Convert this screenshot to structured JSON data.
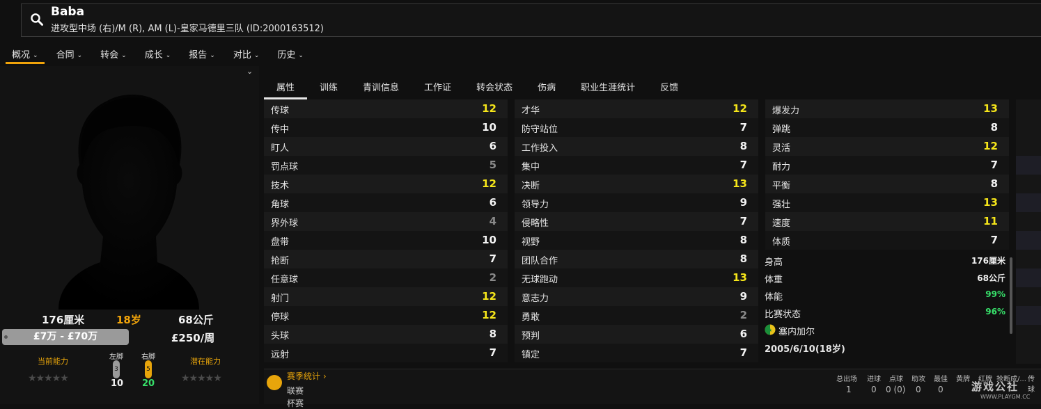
{
  "header": {
    "name": "Baba",
    "subtitle": "进攻型中场 (右)/M (R), AM (L)-皇家马德里三队 (ID:2000163512)"
  },
  "menu": [
    "概况",
    "合同",
    "转会",
    "成长",
    "报告",
    "对比",
    "历史"
  ],
  "player": {
    "height": "176厘米",
    "age": "18岁",
    "weight": "68公斤",
    "value": "£7万 - £70万",
    "wage": "£250/周",
    "current_ability_label": "当前能力",
    "potential_ability_label": "潜在能力",
    "left_foot_label": "左脚",
    "right_foot_label": "右脚",
    "left_foot_badge": "3",
    "right_foot_badge": "5",
    "left_foot_value": "10",
    "right_foot_value": "20"
  },
  "tabs": [
    "属性",
    "训练",
    "青训信息",
    "工作证",
    "转会状态",
    "伤病",
    "职业生涯统计",
    "反馈"
  ],
  "attributes": {
    "technical": [
      {
        "label": "传球",
        "value": "12",
        "tone": "y"
      },
      {
        "label": "传中",
        "value": "10",
        "tone": "w"
      },
      {
        "label": "盯人",
        "value": "6",
        "tone": "w"
      },
      {
        "label": "罚点球",
        "value": "5",
        "tone": "g"
      },
      {
        "label": "技术",
        "value": "12",
        "tone": "y"
      },
      {
        "label": "角球",
        "value": "6",
        "tone": "w"
      },
      {
        "label": "界外球",
        "value": "4",
        "tone": "g"
      },
      {
        "label": "盘带",
        "value": "10",
        "tone": "w"
      },
      {
        "label": "抢断",
        "value": "7",
        "tone": "w"
      },
      {
        "label": "任意球",
        "value": "2",
        "tone": "g"
      },
      {
        "label": "射门",
        "value": "12",
        "tone": "y"
      },
      {
        "label": "停球",
        "value": "12",
        "tone": "y"
      },
      {
        "label": "头球",
        "value": "8",
        "tone": "w"
      },
      {
        "label": "远射",
        "value": "7",
        "tone": "w"
      }
    ],
    "mental": [
      {
        "label": "才华",
        "value": "12",
        "tone": "y"
      },
      {
        "label": "防守站位",
        "value": "7",
        "tone": "w"
      },
      {
        "label": "工作投入",
        "value": "8",
        "tone": "w"
      },
      {
        "label": "集中",
        "value": "7",
        "tone": "w"
      },
      {
        "label": "决断",
        "value": "13",
        "tone": "y"
      },
      {
        "label": "领导力",
        "value": "9",
        "tone": "w"
      },
      {
        "label": "侵略性",
        "value": "7",
        "tone": "w"
      },
      {
        "label": "视野",
        "value": "8",
        "tone": "w"
      },
      {
        "label": "团队合作",
        "value": "8",
        "tone": "w"
      },
      {
        "label": "无球跑动",
        "value": "13",
        "tone": "y"
      },
      {
        "label": "意志力",
        "value": "9",
        "tone": "w"
      },
      {
        "label": "勇敢",
        "value": "2",
        "tone": "g"
      },
      {
        "label": "预判",
        "value": "6",
        "tone": "w"
      },
      {
        "label": "镇定",
        "value": "7",
        "tone": "w"
      }
    ],
    "physical": [
      {
        "label": "爆发力",
        "value": "13",
        "tone": "y"
      },
      {
        "label": "弹跳",
        "value": "8",
        "tone": "w"
      },
      {
        "label": "灵活",
        "value": "12",
        "tone": "y"
      },
      {
        "label": "耐力",
        "value": "7",
        "tone": "w"
      },
      {
        "label": "平衡",
        "value": "8",
        "tone": "w"
      },
      {
        "label": "强壮",
        "value": "13",
        "tone": "y"
      },
      {
        "label": "速度",
        "value": "11",
        "tone": "y"
      },
      {
        "label": "体质",
        "value": "7",
        "tone": "w"
      }
    ]
  },
  "info": {
    "height_label": "身高",
    "height_value": "176厘米",
    "weight_label": "体重",
    "weight_value": "68公斤",
    "fitness_label": "体能",
    "fitness_value": "99%",
    "form_label": "比赛状态",
    "form_value": "96%",
    "nation": "塞内加尔",
    "dob": "2005/6/10(18岁)"
  },
  "season": {
    "title": "赛季统计",
    "row1": "联赛",
    "row2": "杯赛",
    "headers": [
      "总出场",
      "进球",
      "点球",
      "助攻",
      "最佳",
      "黄牌",
      "红牌",
      "抢断成/...",
      "传球"
    ],
    "values": [
      "1",
      "0",
      "0 (0)",
      "0",
      "0"
    ]
  },
  "watermark": "游戏公社",
  "watermark_url": "WWW.PLAYGM.CC",
  "colors": {
    "accent": "#f0a30a",
    "high": "#f6e61a",
    "green": "#37e06a"
  }
}
